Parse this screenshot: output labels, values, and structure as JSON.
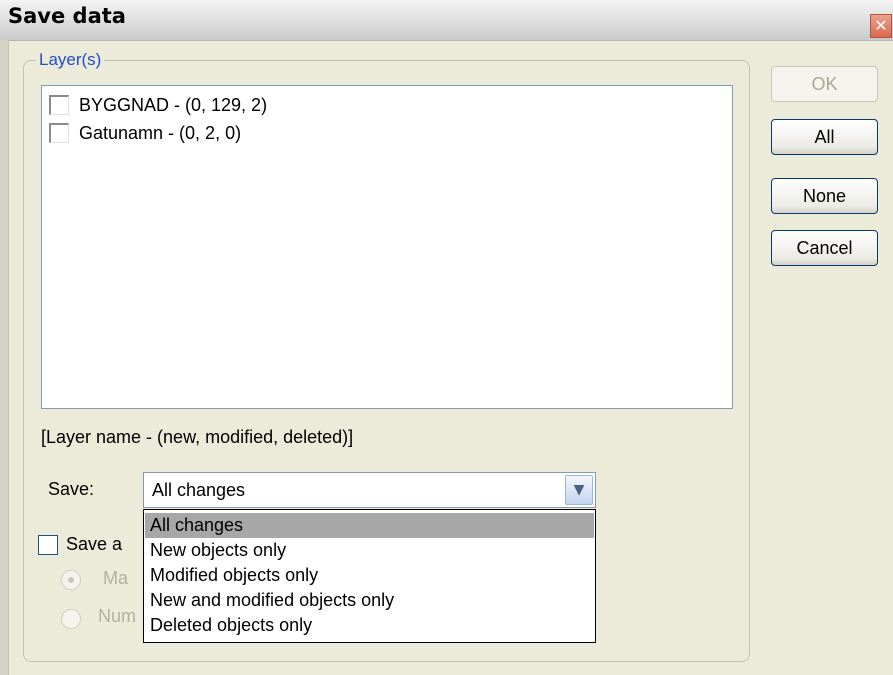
{
  "window": {
    "title": "Save data",
    "close_icon": "close-icon"
  },
  "group": {
    "label": "Layer(s)"
  },
  "layers": [
    {
      "label": "BYGGNAD - (0, 129, 2)",
      "checked": false
    },
    {
      "label": "Gatunamn - (0, 2, 0)",
      "checked": false
    }
  ],
  "legend": "[Layer name - (new, modified, deleted)]",
  "save": {
    "label": "Save:",
    "value": "All changes",
    "options": [
      "All changes",
      "New objects only",
      "Modified objects only",
      "New and modified objects only",
      "Deleted objects only"
    ]
  },
  "save_as": {
    "label": "Save a",
    "radio1": "Ma",
    "radio2": "Num"
  },
  "buttons": {
    "ok": "OK",
    "all": "All",
    "none": "None",
    "cancel": "Cancel"
  }
}
